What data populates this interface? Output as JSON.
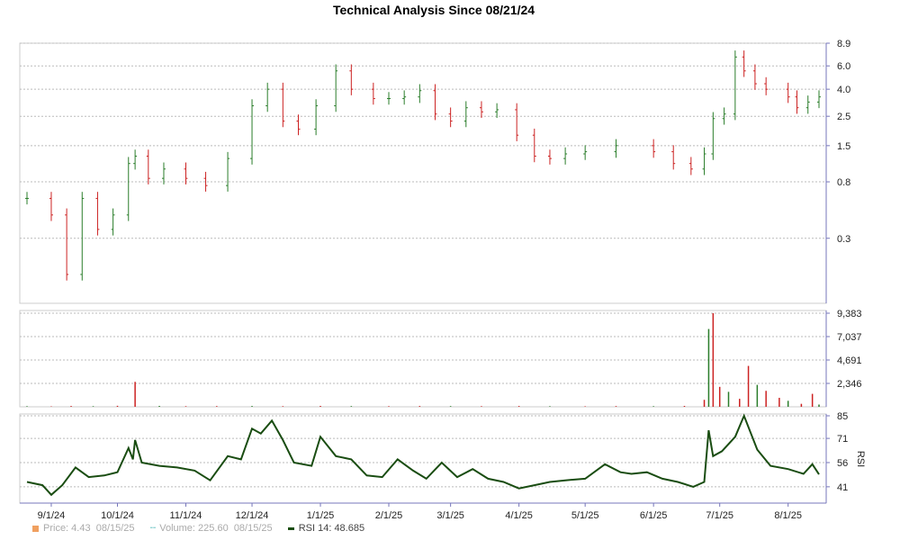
{
  "title": "Technical Analysis Since 08/21/24",
  "colors": {
    "up": "#2a7d2a",
    "down": "#cc2222",
    "rsi": "#1a4d12",
    "grid": "#bbbbbb",
    "axis": "#7777bb",
    "legend_price": "#f0a060",
    "legend_volume": "#55bbbb"
  },
  "legend": {
    "price": "Price: 4.43",
    "price_date": "08/15/25",
    "volume": "Volume: 225.60",
    "volume_date": "08/15/25",
    "rsi": "RSI 14: 48.685"
  },
  "chart_data": [
    {
      "type": "line",
      "title": "Technical Analysis Since 08/21/24",
      "panel": "price",
      "scale": "log",
      "y_ticks": [
        "8.9",
        "6.0",
        "4.0",
        "2.5",
        "1.5",
        "0.8",
        "0.3"
      ],
      "x_ticks": [
        "9/1/24",
        "10/1/24",
        "11/1/24",
        "12/1/24",
        "1/1/25",
        "2/1/25",
        "3/1/25",
        "4/1/25",
        "5/1/25",
        "6/1/25",
        "7/1/25",
        "8/1/25"
      ],
      "series": [
        {
          "x": [
            "8/21/24",
            "9/1/24",
            "9/8/24",
            "9/15/24",
            "9/22/24",
            "9/29/24",
            "10/6/24",
            "10/9/24",
            "10/15/24",
            "10/22/24",
            "11/1/24",
            "11/10/24",
            "11/20/24",
            "12/1/24",
            "12/8/24",
            "12/15/24",
            "12/22/24",
            "12/30/24",
            "1/8/25",
            "1/15/25",
            "1/25/25",
            "2/1/25",
            "2/8/25",
            "2/15/25",
            "2/22/25",
            "3/1/25",
            "3/8/25",
            "3/15/25",
            "3/22/25",
            "3/31/25",
            "4/8/25",
            "4/15/25",
            "4/22/25",
            "5/1/25",
            "5/15/25",
            "6/1/25",
            "6/10/25",
            "6/18/25",
            "6/24/25",
            "6/28/25",
            "7/3/25",
            "7/8/25",
            "7/12/25",
            "7/17/25",
            "7/22/25",
            "8/1/25",
            "8/5/25",
            "8/10/25",
            "8/15/25"
          ],
          "values": [
            0.6,
            0.45,
            0.16,
            0.6,
            0.35,
            0.45,
            1.1,
            1.25,
            0.85,
            1.0,
            0.85,
            0.75,
            1.2,
            3.0,
            4.0,
            2.3,
            2.0,
            3.0,
            5.5,
            4.0,
            3.4,
            3.4,
            3.5,
            3.9,
            2.6,
            2.3,
            2.9,
            2.7,
            2.8,
            1.8,
            1.25,
            1.2,
            1.3,
            1.35,
            1.5,
            1.35,
            1.1,
            1.0,
            1.3,
            2.4,
            2.6,
            7.0,
            5.5,
            4.4,
            4.0,
            3.5,
            2.9,
            3.2,
            3.5
          ]
        }
      ]
    },
    {
      "type": "bar",
      "panel": "volume",
      "y_ticks": [
        "9,383",
        "7,037",
        "4,691",
        "2,346"
      ],
      "ylim": [
        0,
        9383
      ],
      "x": [
        "8/21/24",
        "9/1/24",
        "9/10/24",
        "9/20/24",
        "10/1/24",
        "10/9/24",
        "10/20/24",
        "11/1/24",
        "11/15/24",
        "12/1/24",
        "12/15/24",
        "1/1/25",
        "1/15/25",
        "2/1/25",
        "2/15/25",
        "3/1/25",
        "3/15/25",
        "4/1/25",
        "4/15/25",
        "5/1/25",
        "5/15/25",
        "6/1/25",
        "6/15/25",
        "6/24/25",
        "6/26/25",
        "6/28/25",
        "7/1/25",
        "7/5/25",
        "7/10/25",
        "7/14/25",
        "7/18/25",
        "7/22/25",
        "7/28/25",
        "8/1/25",
        "8/7/25",
        "8/12/25",
        "8/15/25"
      ],
      "values": [
        60,
        40,
        80,
        60,
        100,
        2500,
        90,
        60,
        70,
        80,
        60,
        90,
        70,
        60,
        80,
        70,
        60,
        80,
        60,
        50,
        70,
        60,
        90,
        700,
        7800,
        9383,
        2000,
        1500,
        800,
        4100,
        2200,
        1600,
        900,
        600,
        300,
        1300,
        226
      ]
    },
    {
      "type": "line",
      "panel": "rsi",
      "title": "RSI",
      "y_ticks": [
        "85",
        "71",
        "56",
        "41"
      ],
      "ylim": [
        32,
        85
      ],
      "x": [
        "8/21/24",
        "8/28/24",
        "9/1/24",
        "9/6/24",
        "9/12/24",
        "9/18/24",
        "9/25/24",
        "10/1/24",
        "10/6/24",
        "10/8/24",
        "10/9/24",
        "10/12/24",
        "10/20/24",
        "10/28/24",
        "11/5/24",
        "11/12/24",
        "11/20/24",
        "11/26/24",
        "12/1/24",
        "12/5/24",
        "12/10/24",
        "12/15/24",
        "12/20/24",
        "12/28/24",
        "1/1/25",
        "1/8/25",
        "1/15/25",
        "1/22/25",
        "1/29/25",
        "2/5/25",
        "2/12/25",
        "2/18/25",
        "2/25/25",
        "3/4/25",
        "3/11/25",
        "3/18/25",
        "3/25/25",
        "4/1/25",
        "4/8/25",
        "4/15/25",
        "4/22/25",
        "5/1/25",
        "5/10/25",
        "5/17/25",
        "5/22/25",
        "5/29/25",
        "6/5/25",
        "6/12/25",
        "6/19/25",
        "6/24/25",
        "6/26/25",
        "6/28/25",
        "7/2/25",
        "7/8/25",
        "7/12/25",
        "7/18/25",
        "7/24/25",
        "8/1/25",
        "8/8/25",
        "8/12/25",
        "8/15/25"
      ],
      "values": [
        44,
        42,
        36,
        42,
        53,
        47,
        48,
        50,
        65,
        58,
        70,
        56,
        54,
        53,
        51,
        45,
        60,
        58,
        77,
        74,
        82,
        70,
        56,
        54,
        72,
        60,
        58,
        48,
        47,
        58,
        51,
        46,
        56,
        47,
        52,
        46,
        44,
        40,
        42,
        44,
        45,
        46,
        55,
        50,
        49,
        50,
        46,
        44,
        41,
        44,
        76,
        60,
        63,
        72,
        85,
        64,
        54,
        52,
        49,
        55,
        48.685
      ]
    }
  ]
}
